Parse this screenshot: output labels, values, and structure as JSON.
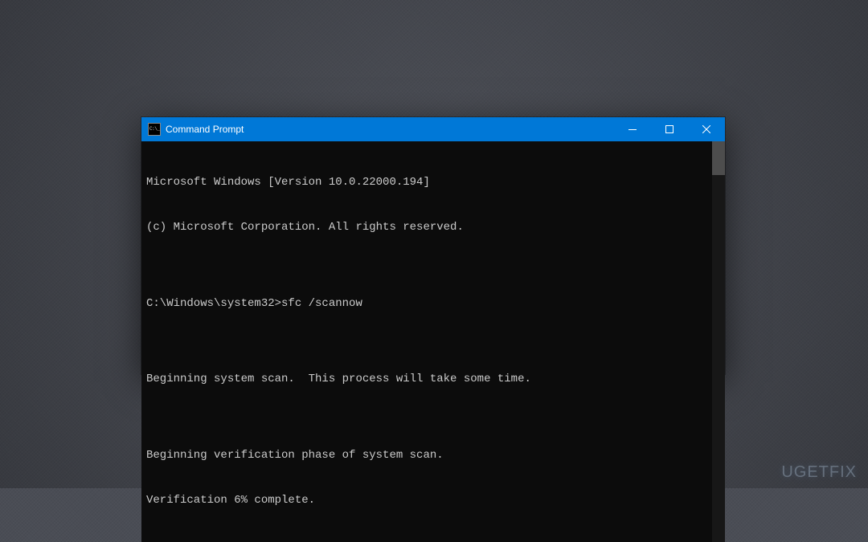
{
  "window": {
    "title": "Command Prompt",
    "icon_label": "C:\\_"
  },
  "terminal": {
    "lines": [
      "Microsoft Windows [Version 10.0.22000.194]",
      "(c) Microsoft Corporation. All rights reserved.",
      "",
      "C:\\Windows\\system32>sfc /scannow",
      "",
      "Beginning system scan.  This process will take some time.",
      "",
      "Beginning verification phase of system scan.",
      "Verification 6% complete."
    ]
  },
  "watermark": {
    "text": "UGETFIX"
  }
}
